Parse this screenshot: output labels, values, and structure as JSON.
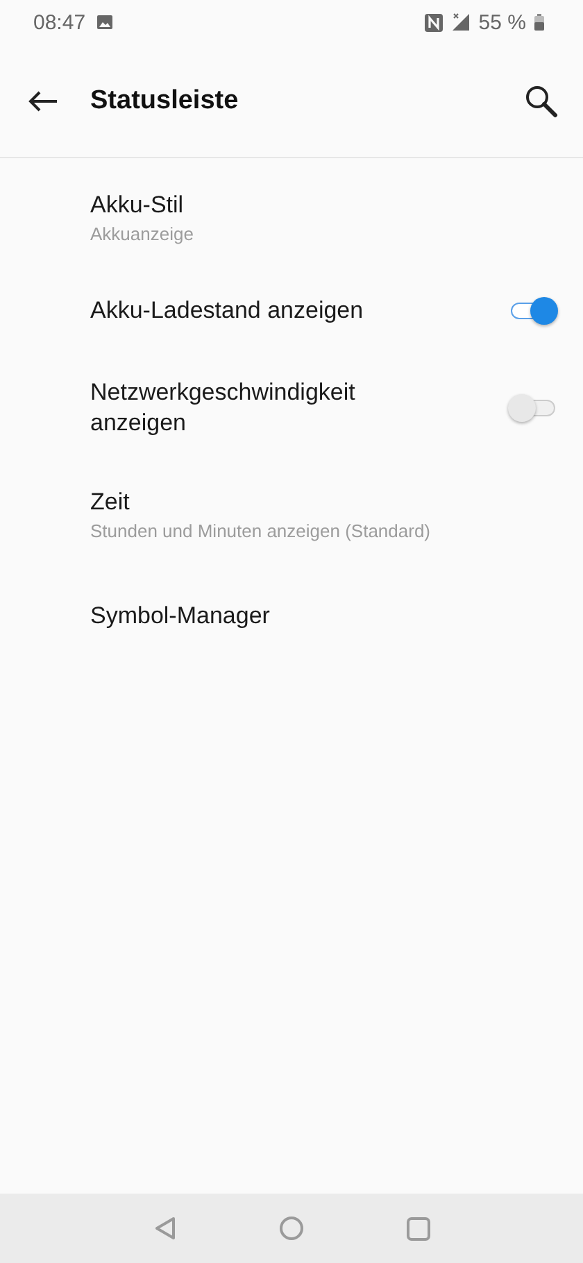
{
  "status_bar": {
    "time": "08:47",
    "battery": "55 %"
  },
  "app_bar": {
    "title": "Statusleiste"
  },
  "items": [
    {
      "kind": "text",
      "title": "Akku-Stil",
      "summary": "Akkuanzeige"
    },
    {
      "kind": "switch",
      "title": "Akku-Ladestand anzeigen",
      "on": true
    },
    {
      "kind": "switch",
      "title": "Netzwerkgeschwindigkeit anzeigen",
      "on": false
    },
    {
      "kind": "text",
      "title": "Zeit",
      "summary": "Stunden und Minuten anzeigen (Standard)"
    },
    {
      "kind": "text",
      "title": "Symbol-Manager"
    }
  ]
}
